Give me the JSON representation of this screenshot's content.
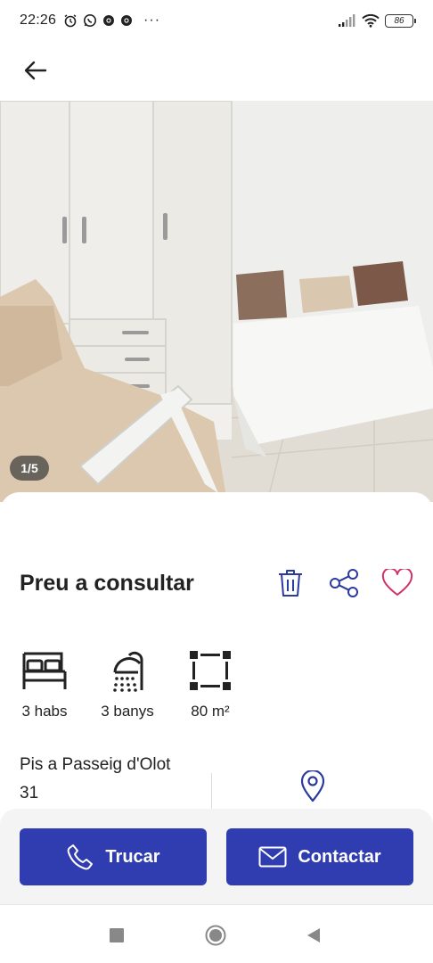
{
  "status_bar": {
    "time": "22:26",
    "more": "···",
    "battery": "86",
    "icons": [
      "alarm-icon",
      "whatsapp-icon",
      "chrome-icon",
      "chrome-icon",
      "signal-icon",
      "wifi-icon",
      "battery-icon"
    ]
  },
  "header": {
    "back_icon": "arrow-left-icon"
  },
  "gallery": {
    "counter": "1/5"
  },
  "listing": {
    "price": "Preu a consultar",
    "actions": [
      "trash-icon",
      "share-icon",
      "heart-icon"
    ],
    "features": [
      {
        "icon": "bed-icon",
        "label": "3 habs"
      },
      {
        "icon": "shower-icon",
        "label": "3 banys"
      },
      {
        "icon": "area-icon",
        "label": "80 m²"
      }
    ],
    "address_line1": "Pis a  Passeig d'Olot",
    "address_line2": "31"
  },
  "buttons": {
    "call": "Trucar",
    "contact": "Contactar"
  },
  "colors": {
    "primary": "#2f3db0",
    "icon_blue": "#2b3a9e",
    "heart": "#d0306a",
    "text": "#222222"
  }
}
